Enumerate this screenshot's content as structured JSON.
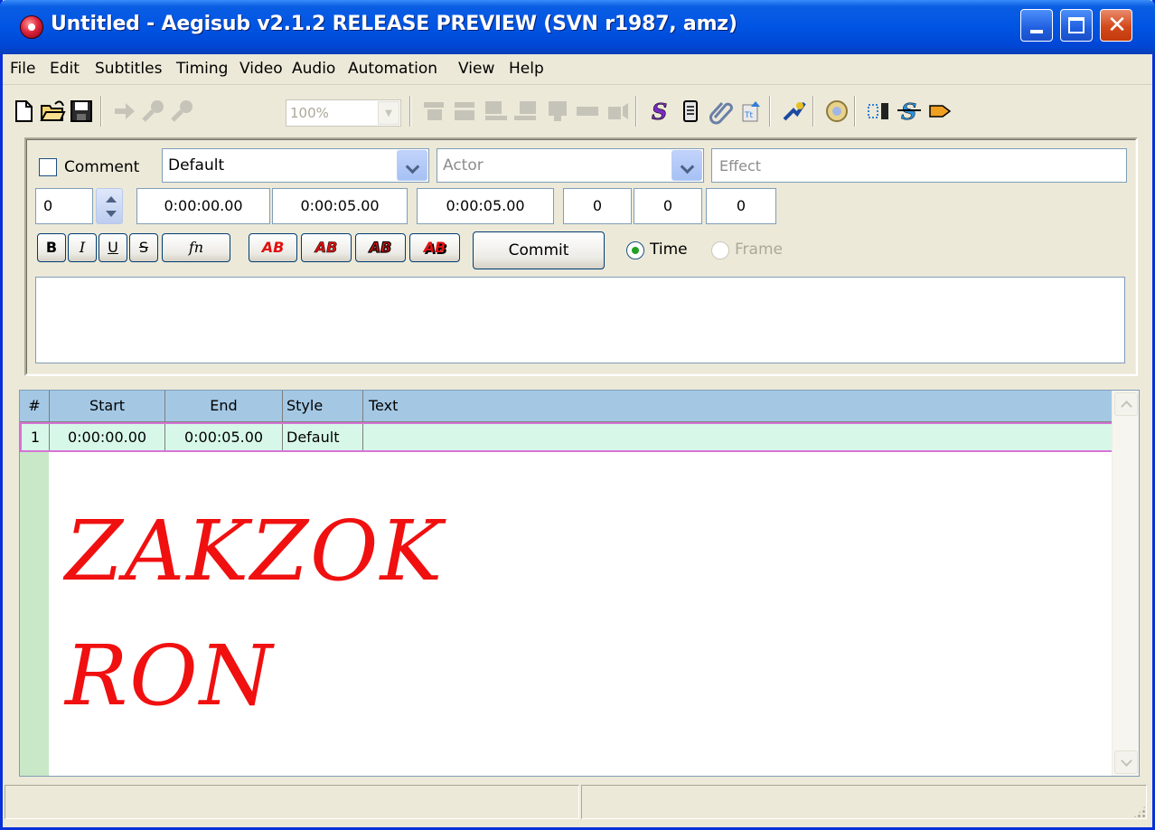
{
  "window": {
    "title": "Untitled - Aegisub v2.1.2 RELEASE PREVIEW (SVN r1987, amz)",
    "close_glyph": "✕"
  },
  "menu": [
    "File",
    "Edit",
    "Subtitles",
    "Timing",
    "Video",
    "Audio",
    "Automation",
    "View",
    "Help"
  ],
  "toolbar": {
    "zoom_value": "100%",
    "icons": [
      "new-file-icon",
      "open-folder-icon",
      "save-icon",
      "jump-to-icon",
      "zoom-in-icon",
      "zoom-out-icon",
      "set-start-icon",
      "set-end-icon",
      "snap-start-icon",
      "snap-end-icon",
      "snap-scene-icon",
      "shift-icon",
      "keyframe-icon",
      "styles-manager-icon",
      "properties-icon",
      "attachments-icon",
      "fonts-collector-icon",
      "automation-icon",
      "options-icon",
      "timing-processor-icon",
      "translation-icon",
      "kanji-timer-icon"
    ]
  },
  "edit": {
    "comment_label": "Comment",
    "style_value": "Default",
    "actor_placeholder": "Actor",
    "effect_placeholder": "Effect",
    "layer": "0",
    "start_time": "0:00:00.00",
    "end_time": "0:00:05.00",
    "duration": "0:00:05.00",
    "margin_left": "0",
    "margin_right": "0",
    "margin_vertical": "0",
    "format_buttons": [
      "B",
      "I",
      "U",
      "S",
      "fn"
    ],
    "color_buttons": [
      "AB",
      "AB",
      "AB",
      "AB"
    ],
    "commit_label": "Commit",
    "radio_time": "Time",
    "radio_frame": "Frame"
  },
  "grid": {
    "headers": [
      "#",
      "Start",
      "End",
      "Style",
      "Text"
    ],
    "rows": [
      {
        "num": "1",
        "start": "0:00:00.00",
        "end": "0:00:05.00",
        "style": "Default",
        "text": ""
      }
    ]
  },
  "overlay": {
    "line1": "ZAKZOK",
    "line2": "RON",
    "color": "#f01010"
  },
  "colors": {
    "titlebar": "#0054e3",
    "grid_header": "#a4c8e4",
    "row_bg": "#d7f8e8",
    "row_border": "#d674d6"
  }
}
